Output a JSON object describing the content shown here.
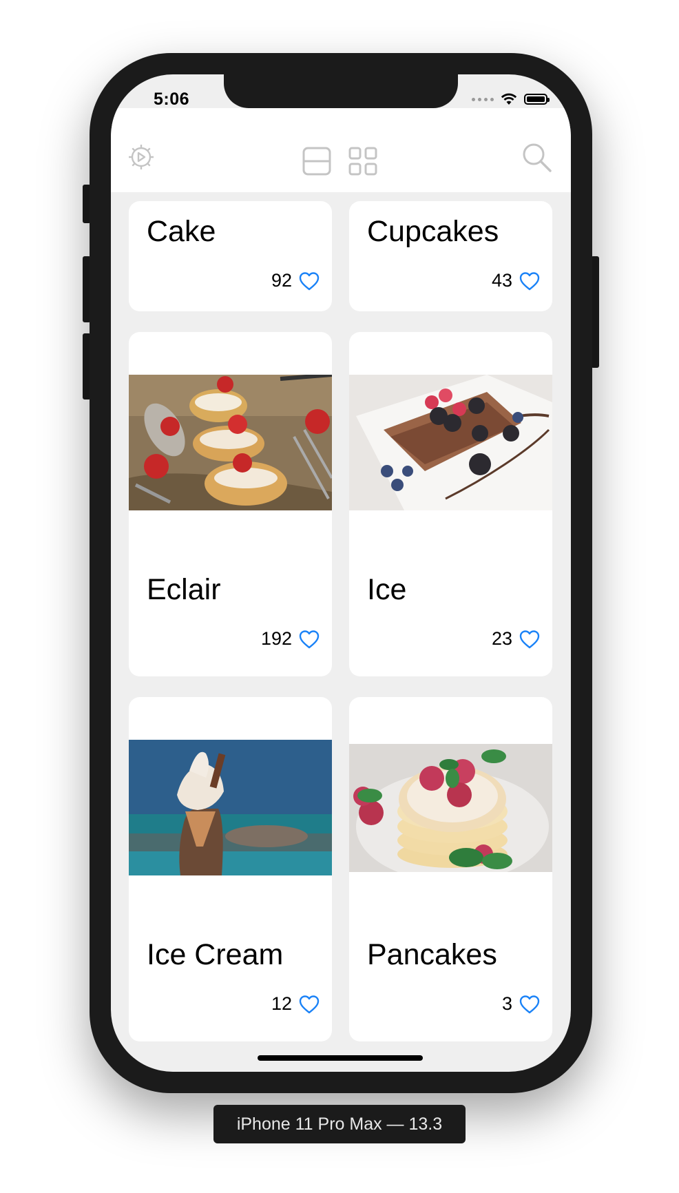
{
  "status_bar": {
    "time": "5:06"
  },
  "toolbar": {
    "settings_icon": "gear-icon",
    "list_layout_icon": "list-layout-icon",
    "grid_layout_icon": "grid-layout-icon",
    "search_icon": "search-icon"
  },
  "colors": {
    "accent": "#1a82f7",
    "background": "#efefef",
    "card": "#ffffff",
    "inactive_icon": "#c4c4c4"
  },
  "cards": [
    {
      "title": "Cake",
      "likes": "92",
      "has_image": false
    },
    {
      "title": "Cupcakes",
      "likes": "43",
      "has_image": false
    },
    {
      "title": "Eclair",
      "likes": "192",
      "image": "eclair-photo"
    },
    {
      "title": "Ice",
      "likes": "23",
      "image": "chocolate-berries-photo"
    },
    {
      "title": "Ice Cream",
      "likes": "12",
      "image": "ice-cream-photo"
    },
    {
      "title": "Pancakes",
      "likes": "3",
      "image": "pancakes-photo"
    }
  ],
  "device_label": "iPhone 11 Pro Max — 13.3"
}
